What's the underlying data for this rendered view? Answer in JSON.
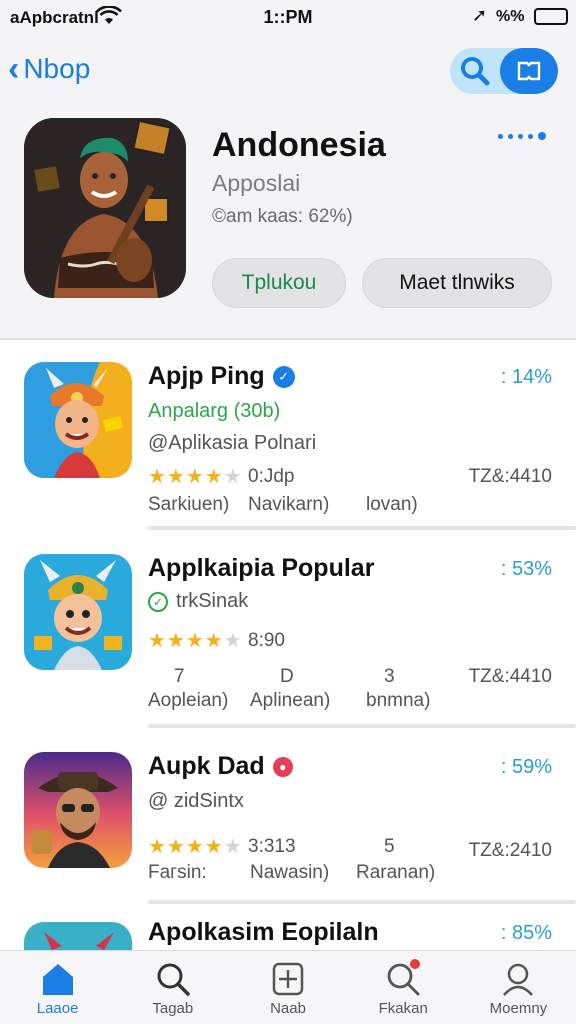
{
  "status": {
    "carrier": "aApbcratnl",
    "time": "1::PM",
    "battery_text": "%%"
  },
  "nav": {
    "back_label": "Nbop"
  },
  "hero": {
    "title": "Andonesia",
    "subtitle": "Apposlai",
    "meta": "©am kaas: 62%)",
    "button_primary": "Tplukou",
    "button_secondary": "Maet tlnwiks"
  },
  "items": [
    {
      "name": "Apjp Ping",
      "badge": "verified",
      "percent": ": 14%",
      "subtitle_green": "Anpalarg (30b)",
      "subtitle": "@Aplikasia Polnari",
      "stars": 4,
      "rating": "0:Jdp",
      "count": "ΤΖ&:4410",
      "labels": [
        "Sarkiuen)",
        "Navikarn)",
        "lovan)"
      ]
    },
    {
      "name": "Applkaipia Popular",
      "percent": ": 53%",
      "subtitle": "trkSinak",
      "stars": 4,
      "rating": "8:90",
      "count": "ΤΖ&:4410",
      "numbers": [
        "7",
        "D",
        "3"
      ],
      "labels": [
        "Aopleian)",
        "Aplinean)",
        "bnmna)"
      ]
    },
    {
      "name": "Aupk Dad",
      "badge": "red",
      "percent": ": 59%",
      "subtitle": "@ zidSintx",
      "stars": 4,
      "rating": "3:313",
      "count": "ΤΖ&:2410",
      "numbers": [
        "5"
      ],
      "labels": [
        "Faгsin:",
        "Nawasin)",
        "Raranan)"
      ]
    },
    {
      "name": "Apolkasim Eopilaln",
      "percent": ": 85%"
    }
  ],
  "tabs": [
    {
      "label": "Laaoe",
      "icon": "home-icon",
      "active": true
    },
    {
      "label": "Tagab",
      "icon": "search-icon"
    },
    {
      "label": "Naab",
      "icon": "plus-box-icon"
    },
    {
      "label": "Fkakan",
      "icon": "search-badge-icon",
      "badge": true
    },
    {
      "label": "Moemny",
      "icon": "person-icon"
    }
  ],
  "colors": {
    "accent": "#1a7ee6",
    "green": "#2aa64a",
    "star": "#f4b21a",
    "percent": "#2aa0c8",
    "background_header": "#f4f4f6"
  }
}
